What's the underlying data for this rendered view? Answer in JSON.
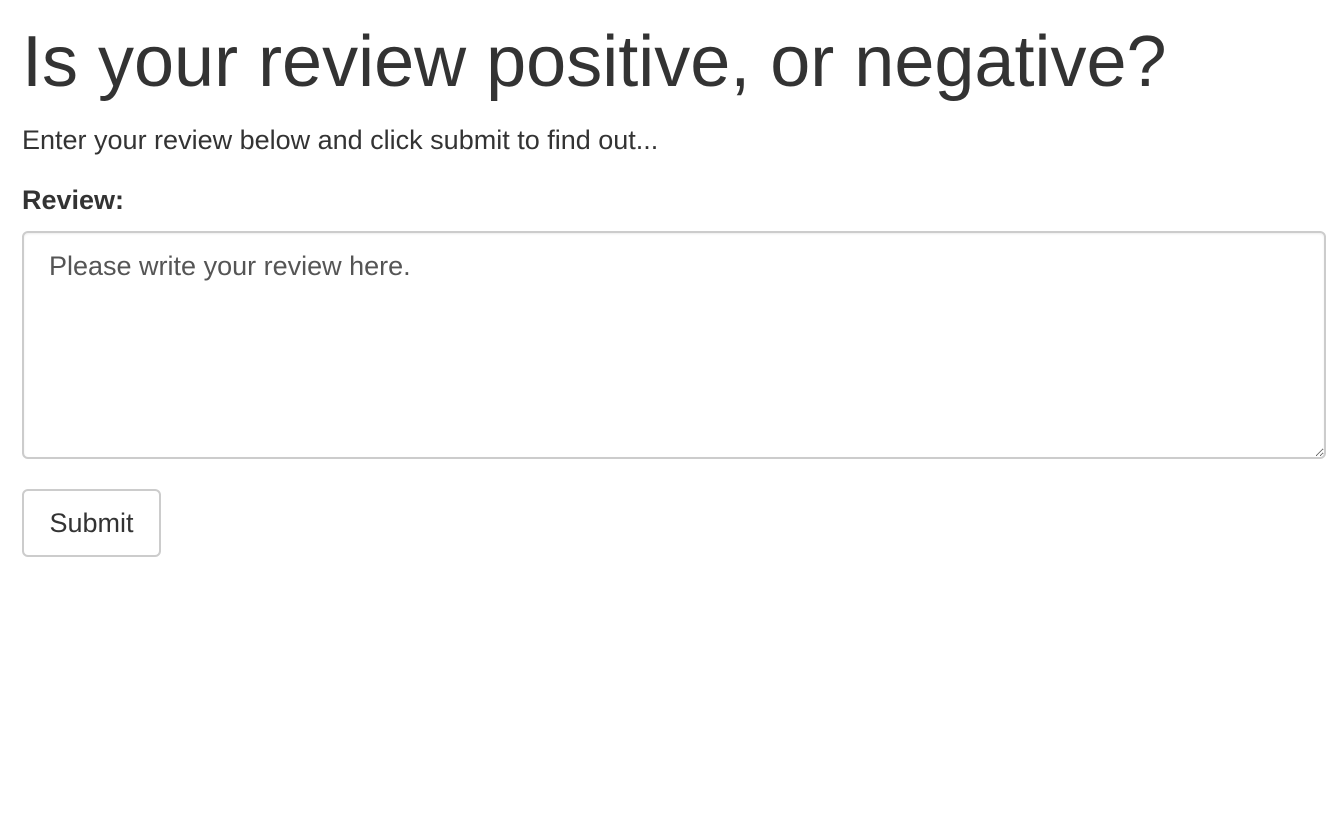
{
  "header": {
    "title": "Is your review positive, or negative?",
    "subtitle": "Enter your review below and click submit to find out..."
  },
  "form": {
    "review_label": "Review:",
    "review_placeholder": "Please write your review here.",
    "review_value": "",
    "submit_label": "Submit"
  }
}
